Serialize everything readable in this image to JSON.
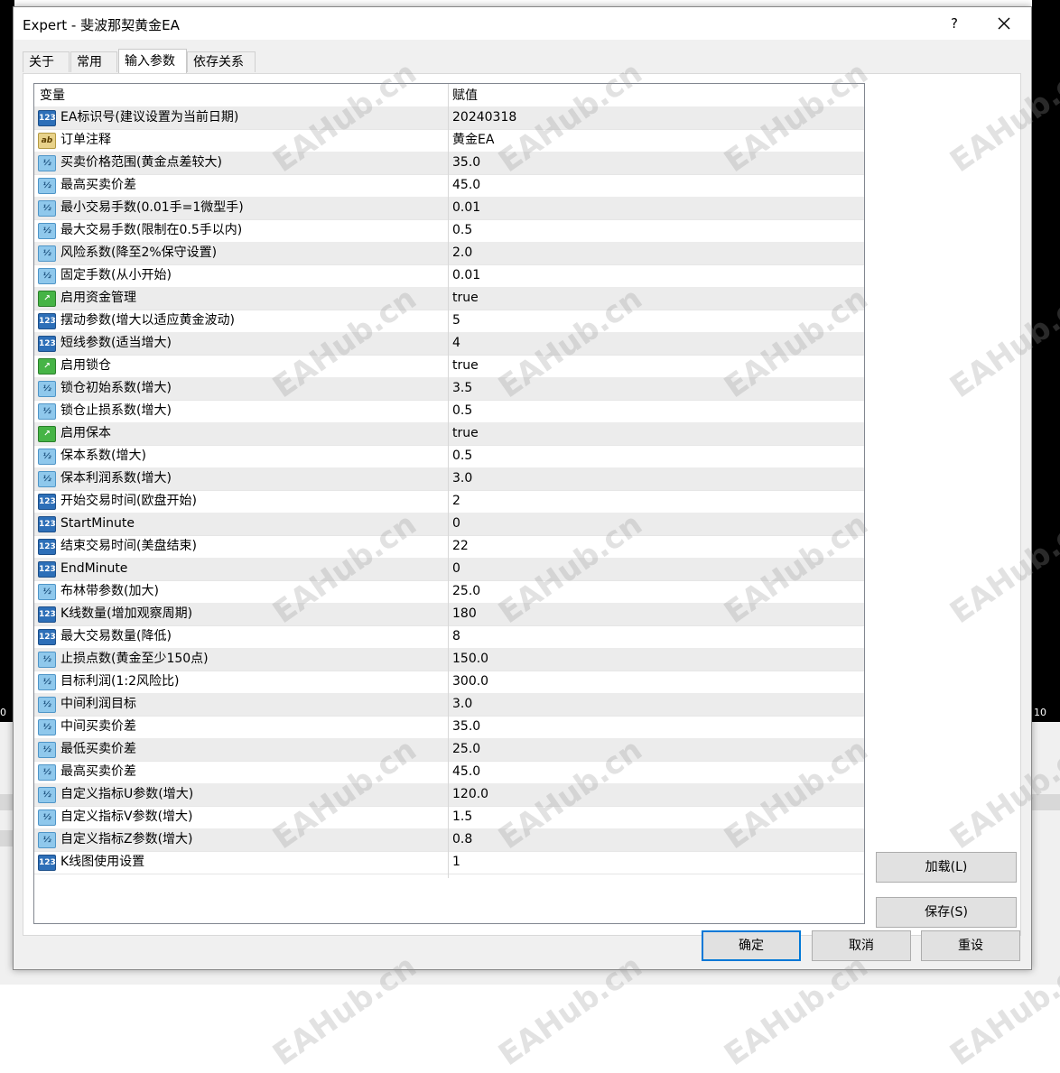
{
  "window": {
    "title": "Expert - 斐波那契黄金EA",
    "help_label": "?"
  },
  "tabs": [
    {
      "label": "关于",
      "active": false
    },
    {
      "label": "常用",
      "active": false
    },
    {
      "label": "输入参数",
      "active": true
    },
    {
      "label": "依存关系",
      "active": false
    }
  ],
  "grid": {
    "header": {
      "name": "变量",
      "value": "赋值"
    },
    "rows": [
      {
        "icon": "int",
        "name": "EA标识号(建议设置为当前日期)",
        "value": "20240318"
      },
      {
        "icon": "str",
        "name": "订单注释",
        "value": "黄金EA"
      },
      {
        "icon": "dbl",
        "name": "买卖价格范围(黄金点差较大)",
        "value": "35.0"
      },
      {
        "icon": "dbl",
        "name": "最高买卖价差",
        "value": "45.0"
      },
      {
        "icon": "dbl",
        "name": "最小交易手数(0.01手=1微型手)",
        "value": "0.01"
      },
      {
        "icon": "dbl",
        "name": "最大交易手数(限制在0.5手以内)",
        "value": "0.5"
      },
      {
        "icon": "dbl",
        "name": "风险系数(降至2%保守设置)",
        "value": "2.0"
      },
      {
        "icon": "dbl",
        "name": "固定手数(从小开始)",
        "value": "0.01"
      },
      {
        "icon": "bool",
        "name": "启用资金管理",
        "value": "true"
      },
      {
        "icon": "int",
        "name": "摆动参数(增大以适应黄金波动)",
        "value": "5"
      },
      {
        "icon": "int",
        "name": "短线参数(适当增大)",
        "value": "4"
      },
      {
        "icon": "bool",
        "name": "启用锁仓",
        "value": "true"
      },
      {
        "icon": "dbl",
        "name": "锁仓初始系数(增大)",
        "value": "3.5"
      },
      {
        "icon": "dbl",
        "name": "锁仓止损系数(增大)",
        "value": "0.5"
      },
      {
        "icon": "bool",
        "name": "启用保本",
        "value": "true"
      },
      {
        "icon": "dbl",
        "name": "保本系数(增大)",
        "value": "0.5"
      },
      {
        "icon": "dbl",
        "name": "保本利润系数(增大)",
        "value": "3.0"
      },
      {
        "icon": "int",
        "name": "开始交易时间(欧盘开始)",
        "value": "2"
      },
      {
        "icon": "int",
        "name": "StartMinute",
        "value": "0"
      },
      {
        "icon": "int",
        "name": "结束交易时间(美盘结束)",
        "value": "22"
      },
      {
        "icon": "int",
        "name": "EndMinute",
        "value": "0"
      },
      {
        "icon": "dbl",
        "name": "布林带参数(加大)",
        "value": "25.0"
      },
      {
        "icon": "int",
        "name": "K线数量(增加观察周期)",
        "value": "180"
      },
      {
        "icon": "int",
        "name": "最大交易数量(降低)",
        "value": "8"
      },
      {
        "icon": "dbl",
        "name": "止损点数(黄金至少150点)",
        "value": "150.0"
      },
      {
        "icon": "dbl",
        "name": "目标利润(1:2风险比)",
        "value": "300.0"
      },
      {
        "icon": "dbl",
        "name": "中间利润目标",
        "value": "3.0"
      },
      {
        "icon": "dbl",
        "name": "中间买卖价差",
        "value": "35.0"
      },
      {
        "icon": "dbl",
        "name": "最低买卖价差",
        "value": "25.0"
      },
      {
        "icon": "dbl",
        "name": "最高买卖价差",
        "value": "45.0"
      },
      {
        "icon": "dbl",
        "name": "自定义指标U参数(增大)",
        "value": "120.0"
      },
      {
        "icon": "dbl",
        "name": "自定义指标V参数(增大)",
        "value": "1.5"
      },
      {
        "icon": "dbl",
        "name": "自定义指标Z参数(增大)",
        "value": "0.8"
      },
      {
        "icon": "int",
        "name": "K线图使用设置",
        "value": "1"
      }
    ]
  },
  "icons": {
    "int": "123",
    "dbl": "½",
    "str": "ab",
    "bool": "↗"
  },
  "buttons": {
    "load": "加载(L)",
    "save": "保存(S)",
    "ok": "确定",
    "cancel": "取消",
    "reset": "重设"
  },
  "background": {
    "tick_left": "0",
    "tick_right": "10"
  },
  "watermark": "EAHub.cn"
}
